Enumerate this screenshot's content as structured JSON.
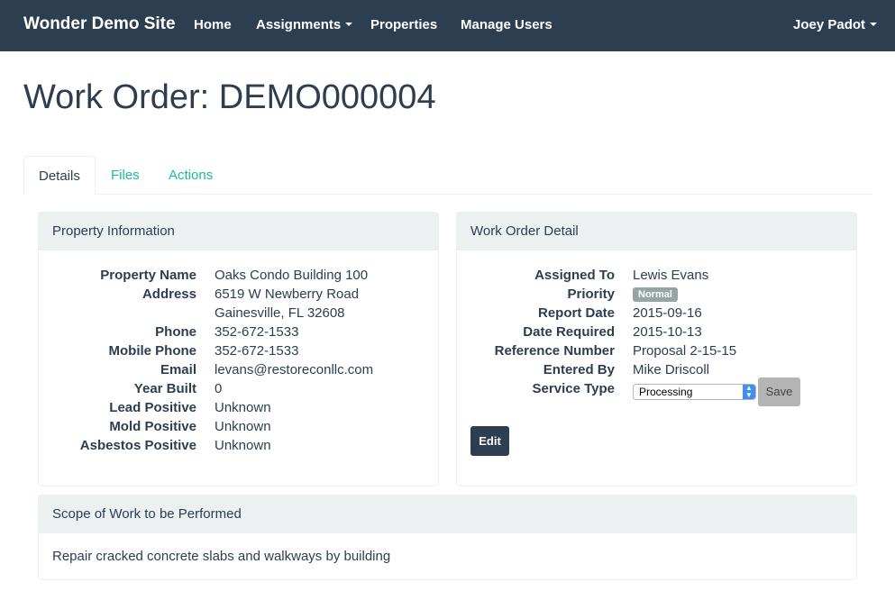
{
  "navbar": {
    "brand": "Wonder Demo Site",
    "items": [
      {
        "label": "Home"
      },
      {
        "label": "Assignments"
      },
      {
        "label": "Properties"
      },
      {
        "label": "Manage Users"
      }
    ],
    "user": "Joey Padot"
  },
  "page": {
    "title": "Work Order: DEMO000004"
  },
  "tabs": [
    {
      "label": "Details"
    },
    {
      "label": "Files"
    },
    {
      "label": "Actions"
    }
  ],
  "property": {
    "heading": "Property Information",
    "fields": {
      "name": {
        "label": "Property Name",
        "value": "Oaks Condo Building 100"
      },
      "address": {
        "label": "Address",
        "line1": "6519 W Newberry Road",
        "line2": "Gainesville, FL 32608"
      },
      "phone": {
        "label": "Phone",
        "value": "352-672-1533"
      },
      "mobile": {
        "label": "Mobile Phone",
        "value": "352-672-1533"
      },
      "email": {
        "label": "Email",
        "value": "levans@restoreconllc.com"
      },
      "year": {
        "label": "Year Built",
        "value": "0"
      },
      "lead": {
        "label": "Lead Positive",
        "value": "Unknown"
      },
      "mold": {
        "label": "Mold Positive",
        "value": "Unknown"
      },
      "asbestos": {
        "label": "Asbestos Positive",
        "value": "Unknown"
      }
    }
  },
  "workorder": {
    "heading": "Work Order Detail",
    "fields": {
      "assigned": {
        "label": "Assigned To",
        "value": "Lewis Evans"
      },
      "priority": {
        "label": "Priority",
        "value": "Normal"
      },
      "report_date": {
        "label": "Report Date",
        "value": "2015-09-16"
      },
      "date_required": {
        "label": "Date Required",
        "value": "2015-10-13"
      },
      "reference": {
        "label": "Reference Number",
        "value": "Proposal 2-15-15"
      },
      "entered_by": {
        "label": "Entered By",
        "value": "Mike Driscoll"
      },
      "service_type": {
        "label": "Service Type",
        "value": "Processing"
      }
    },
    "save_label": "Save",
    "edit_label": "Edit"
  },
  "scope": {
    "heading": "Scope of Work to be Performed",
    "text": "Repair cracked concrete slabs and walkways by building"
  },
  "colors": {
    "navbar": "#2c3e50",
    "accent": "#18bc9c",
    "panel_heading": "#ecf0f1",
    "badge": "#95a5a6"
  }
}
